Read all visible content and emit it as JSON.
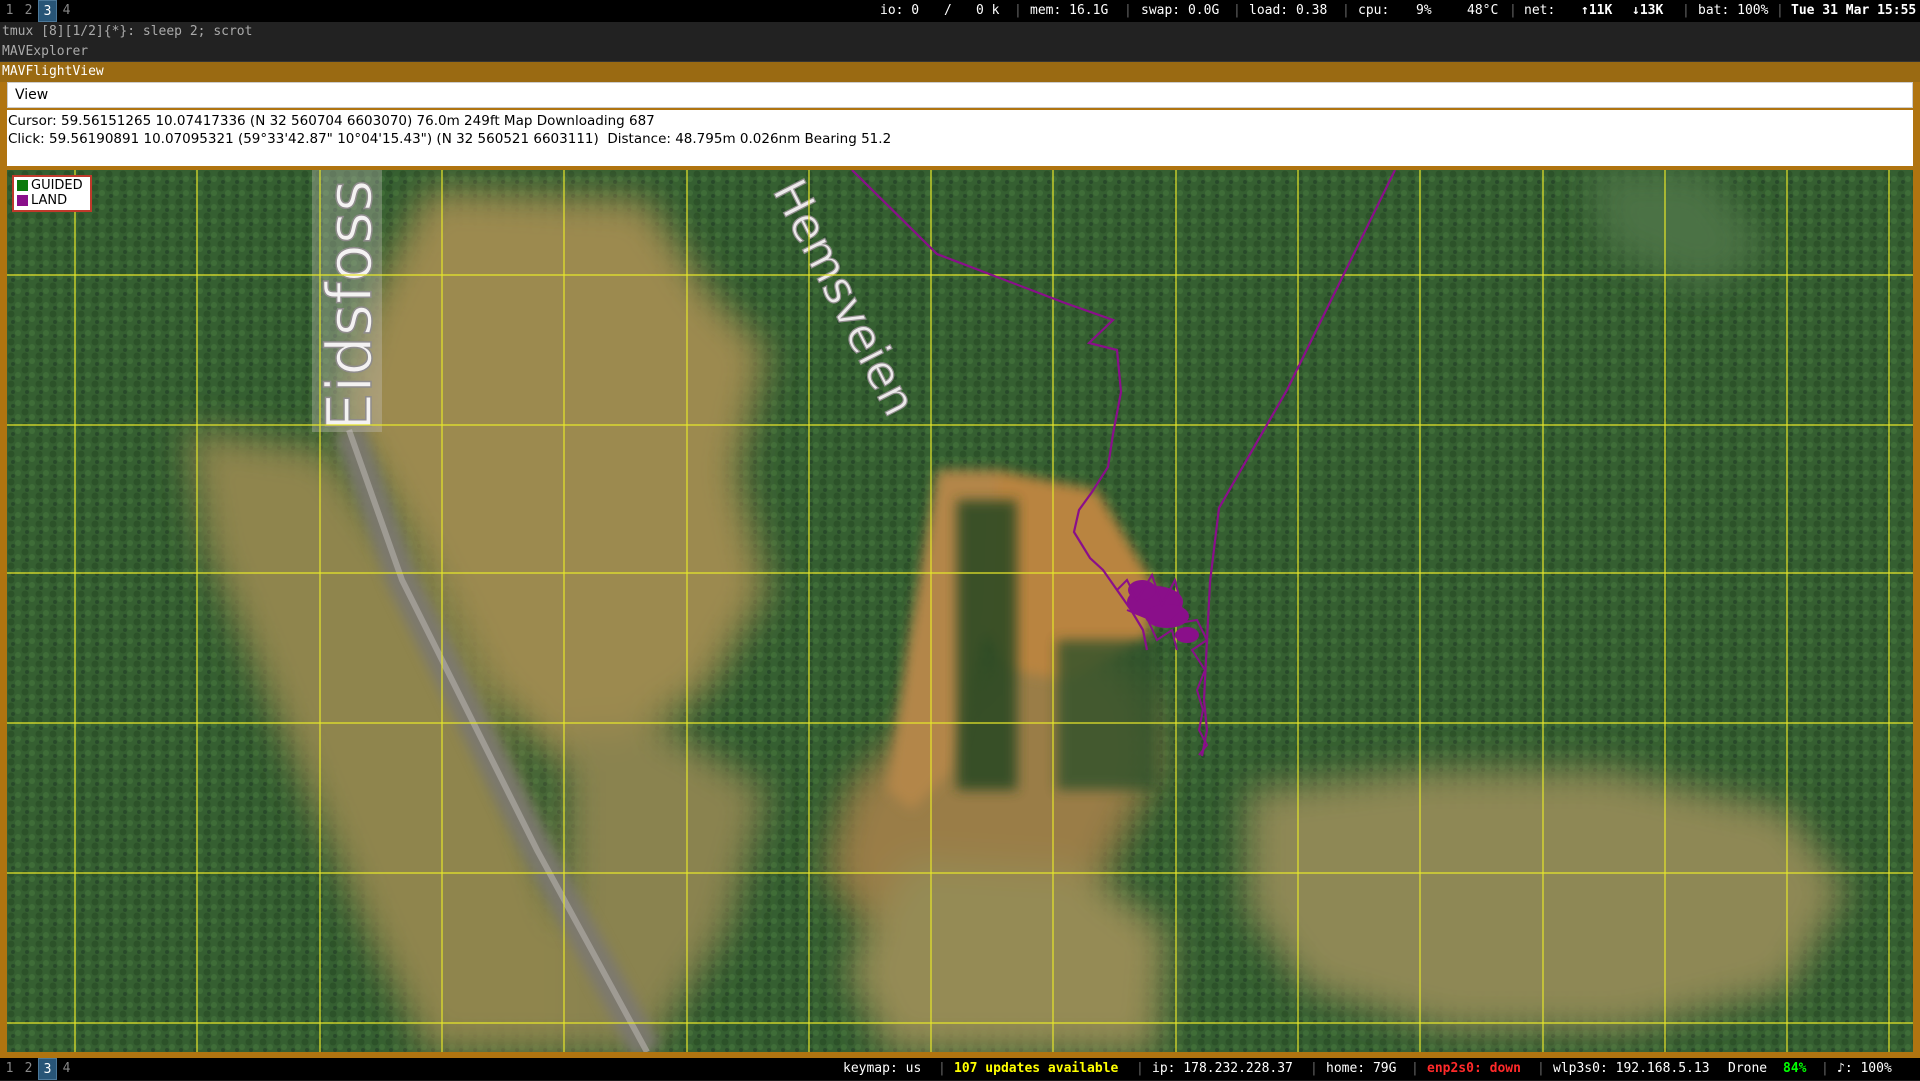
{
  "top_bar": {
    "workspaces": [
      {
        "label": "1",
        "active": false
      },
      {
        "label": "2",
        "active": false
      },
      {
        "label": "3",
        "active": true
      },
      {
        "label": "4",
        "active": false
      }
    ],
    "io": "io: 0",
    "io_sep": "/",
    "io_k": "0 k",
    "mem": "mem: 16.1G",
    "swap": "swap: 0.0G",
    "load": "load: 0.38",
    "cpu_label": "cpu:",
    "cpu_value": "9%",
    "temp": "48°C",
    "net_label": "net:",
    "net_up": "↑11K",
    "net_down": "↓13K",
    "battery": "bat: 100%",
    "datetime": "Tue 31 Mar 15:55"
  },
  "tmux": {
    "status": "tmux [8][1/2]{*}:  sleep 2; scrot"
  },
  "windows": {
    "explorer_title": "MAVExplorer",
    "flightview_title": "MAVFlightView"
  },
  "menu": {
    "view_label": "View"
  },
  "info": {
    "cursor_line": "Cursor: 59.56151265 10.07417336 (N 32 560704 6603070) 76.0m 249ft Map Downloading 687",
    "click_line": "Click: 59.56190891 10.07095321 (59°33'42.87\" 10°04'15.43\") (N 32 560521 6603111)  Distance: 48.795m 0.026nm Bearing 51.2"
  },
  "map": {
    "road_labels": [
      "Eidsfoss",
      "Hemsveien"
    ],
    "legend": [
      {
        "label": "GUIDED",
        "color": "#0b7a0b"
      },
      {
        "label": "LAND",
        "color": "#8a0f8a"
      }
    ],
    "grid_color": "#e6e62a",
    "track_color": "#8a0f8a"
  },
  "bottom_bar": {
    "workspaces": [
      {
        "label": "1",
        "active": false
      },
      {
        "label": "2",
        "active": false
      },
      {
        "label": "3",
        "active": true
      },
      {
        "label": "4",
        "active": false
      }
    ],
    "keymap": "keymap: us",
    "updates": "107 updates available",
    "ip": "ip: 178.232.228.37",
    "home": "home: 79G",
    "enp": "enp2s0: down",
    "wlp": "wlp3s0: 192.168.5.13",
    "wifi_name": "Drone",
    "wifi_quality": "84%",
    "volume": "♪: 100%"
  }
}
